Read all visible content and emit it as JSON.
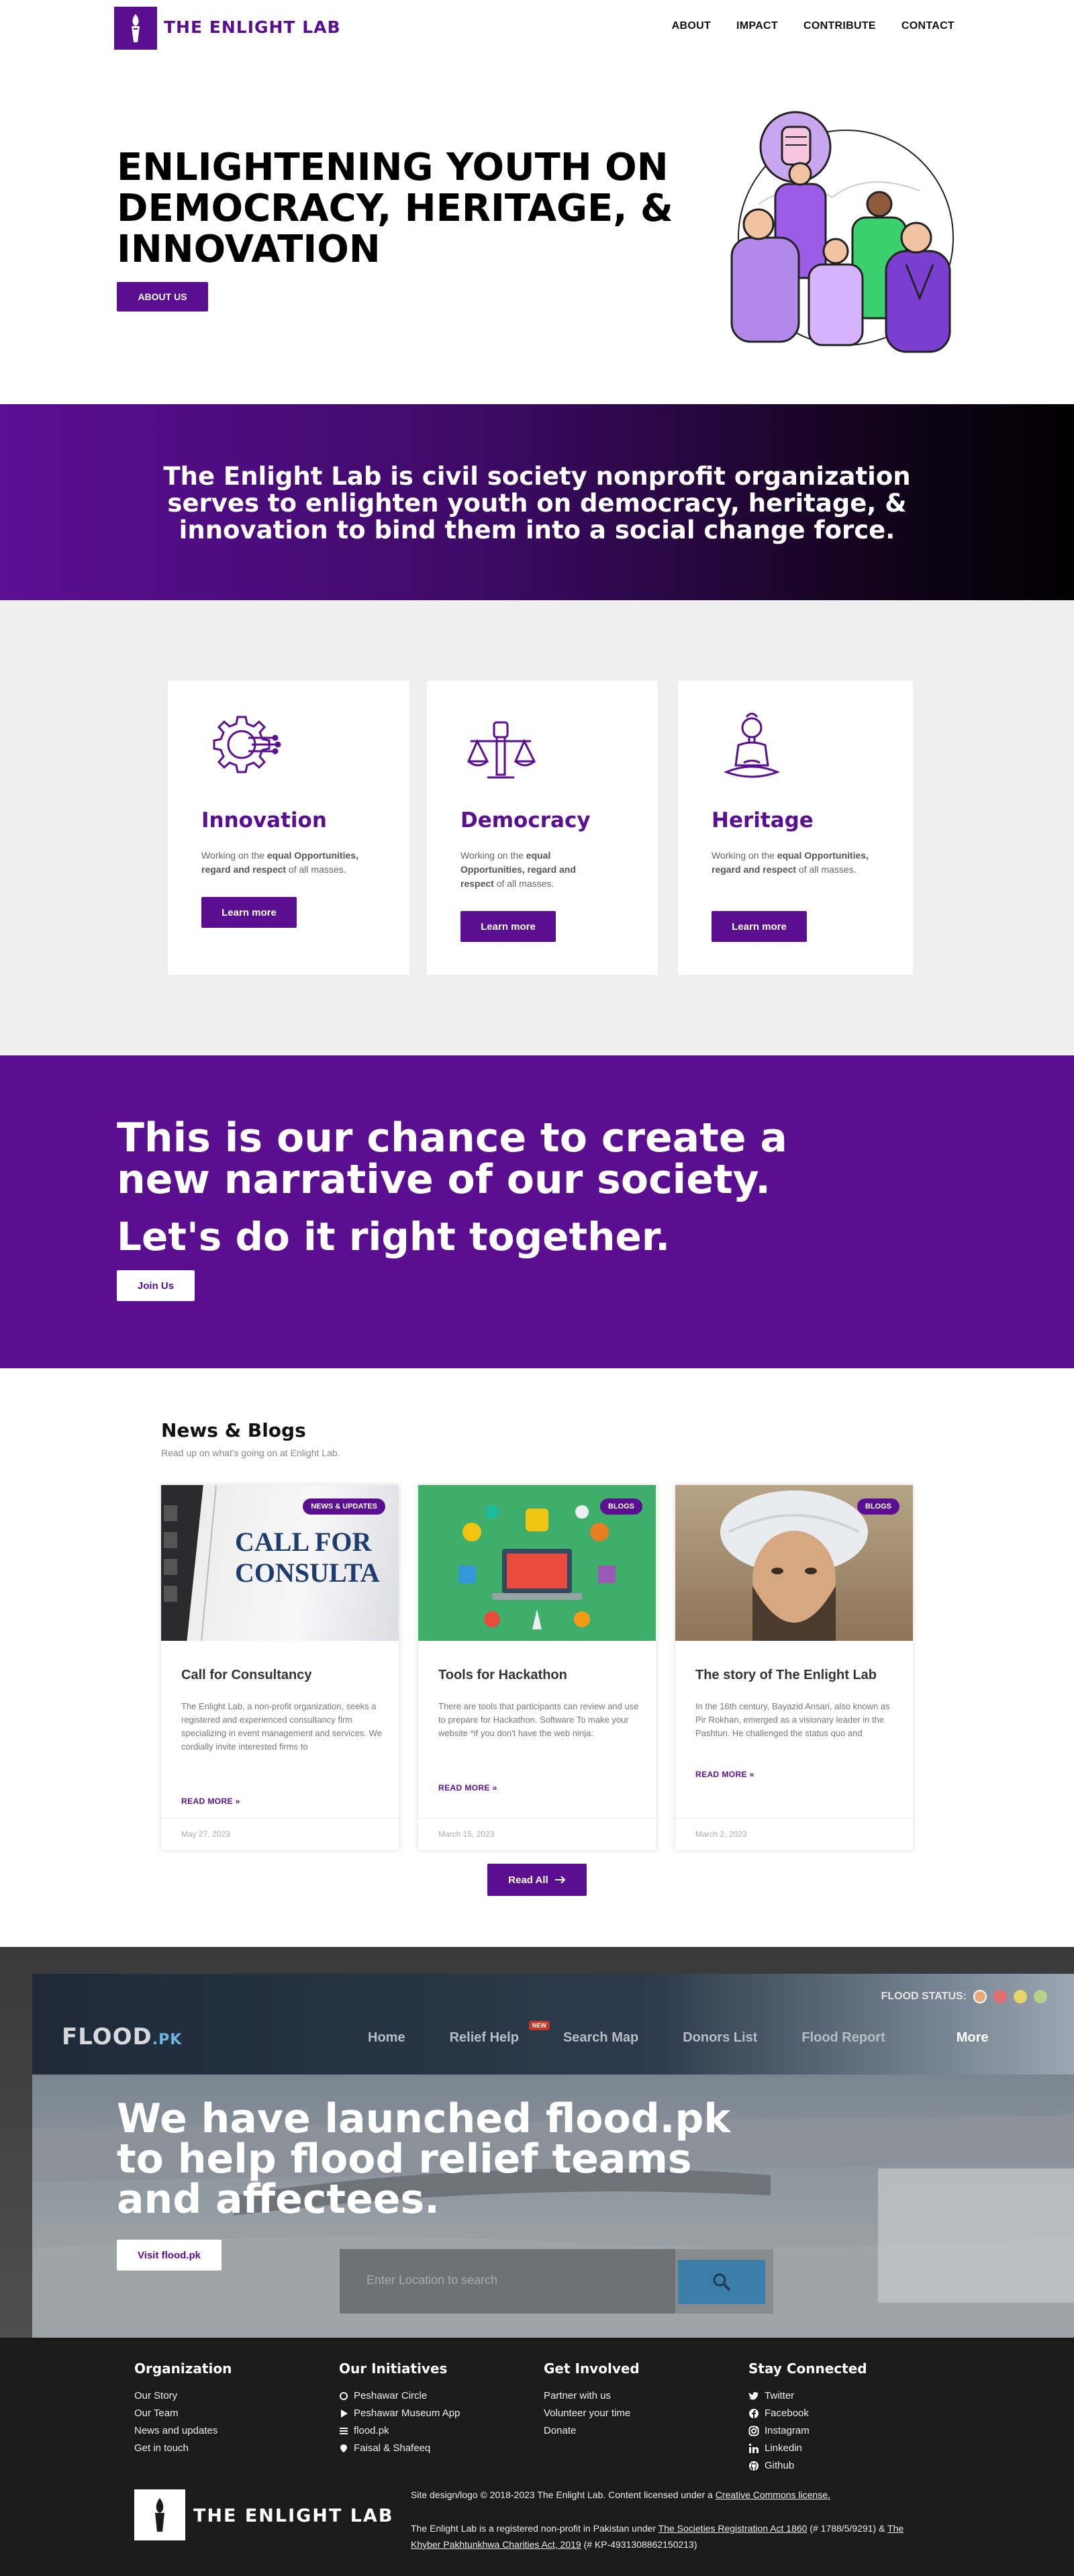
{
  "header": {
    "logo_text": "THE ENLIGHT LAB",
    "nav": [
      "ABOUT",
      "IMPACT",
      "CONTRIBUTE",
      "CONTACT"
    ]
  },
  "hero": {
    "title": "ENLIGHTENING YOUTH ON DEMOCRACY, HERITAGE, & INNOVATION",
    "button": "ABOUT US"
  },
  "mission": {
    "text": "The Enlight Lab is civil society nonprofit organization serves to enlighten youth on democracy, heritage, & innovation to bind them into a social change force."
  },
  "features": {
    "cards": [
      {
        "title": "Innovation",
        "desc_pre": "Working on the ",
        "desc_bold": "equal Opportunities, regard and respect",
        "desc_post": " of all masses.",
        "button": "Learn more",
        "icon": "gear-circuit-icon"
      },
      {
        "title": "Democracy",
        "desc_pre": "Working on the ",
        "desc_bold": "equal Opportunities, regard and respect",
        "desc_post": " of all masses.",
        "button": "Learn more",
        "icon": "scales-fist-icon"
      },
      {
        "title": "Heritage",
        "desc_pre": "Working on the ",
        "desc_bold": "equal Opportunities, regard and respect",
        "desc_post": " of all masses.",
        "button": "Learn more",
        "icon": "buddha-icon"
      }
    ]
  },
  "cta": {
    "line1": "This is our chance to create a new narrative of our society.",
    "line2": "Let's do it right together.",
    "button": "Join Us"
  },
  "news": {
    "title": "News & Blogs",
    "subtitle": "Read up on what's going on at Enlight Lab.",
    "posts": [
      {
        "badge": "NEWS & UPDATES",
        "image_text": "CALL FOR CONSULTA",
        "title": "Call for Consultancy",
        "excerpt": "The Enlight Lab, a non-profit organization, seeks a registered and experienced consultancy firm specializing in event management and services. We cordially invite interested firms to",
        "more": "READ MORE »",
        "date": "May 27, 2023"
      },
      {
        "badge": "BLOGS",
        "title": "Tools for Hackathon",
        "excerpt": "There are tools that participants can review and use to prepare for Hackathon. Software To make your website *if you don't have the web ninja:",
        "more": "READ MORE »",
        "date": "March 15, 2023"
      },
      {
        "badge": "BLOGS",
        "title": "The story of The Enlight Lab",
        "excerpt": "In the 16th century, Bayazid Ansari, also known as Pir Rokhan, emerged as a visionary leader in the Pashtun. He challenged the status quo and",
        "more": "READ MORE »",
        "date": "March 2, 2023"
      }
    ],
    "read_all": "Read All"
  },
  "flood": {
    "status_label": "FLOOD STATUS:",
    "status_colors": [
      "#e8a87c",
      "#e07070",
      "#e6d56a",
      "#b9d08a"
    ],
    "logo": "FLOOD",
    "logo_suffix": ".PK",
    "menu": [
      "Home",
      "Relief Help",
      "Search Map",
      "Donors List",
      "Flood Report",
      "More"
    ],
    "new_badge": "NEW",
    "search_placeholder": "Enter Location to search",
    "title": "We have launched flood.pk to help flood relief teams and affectees.",
    "button": "Visit flood.pk"
  },
  "footer": {
    "columns": [
      {
        "heading": "Organization",
        "items": [
          {
            "label": "Our Story"
          },
          {
            "label": "Our Team"
          },
          {
            "label": "News and updates"
          },
          {
            "label": "Get in touch"
          }
        ]
      },
      {
        "heading": "Our Initiatives",
        "items": [
          {
            "label": "Peshawar Circle",
            "icon": "circle-icon"
          },
          {
            "label": "Peshawar Museum App",
            "icon": "play-icon"
          },
          {
            "label": "flood.pk",
            "icon": "list-icon"
          },
          {
            "label": "Faisal & Shafeeq",
            "icon": "pin-icon"
          }
        ]
      },
      {
        "heading": "Get Involved",
        "items": [
          {
            "label": "Partner with us"
          },
          {
            "label": "Volunteer your time"
          },
          {
            "label": "Donate"
          }
        ]
      },
      {
        "heading": "Stay Connected",
        "items": [
          {
            "label": "Twitter",
            "icon": "twitter-icon"
          },
          {
            "label": "Facebook",
            "icon": "facebook-icon"
          },
          {
            "label": "Instagram",
            "icon": "instagram-icon"
          },
          {
            "label": "Linkedin",
            "icon": "linkedin-icon"
          },
          {
            "label": "Github",
            "icon": "github-icon"
          }
        ]
      }
    ],
    "logo_text": "THE ENLIGHT LAB",
    "copyright_pre": "Site design/logo © 2018-2023 The Enlight Lab. Content licensed under a ",
    "copyright_link": "Creative Commons license.",
    "reg_pre": "The Enlight Lab is a registered non-profit in Pakistan under ",
    "reg_link1": "The Societies Registration Act 1860",
    "reg_mid": " (# 1788/5/9291) & ",
    "reg_link2": "The Khyber Pakhtunkhwa Charities Act, 2019",
    "reg_post": " (# KP-4931308862150213)"
  }
}
